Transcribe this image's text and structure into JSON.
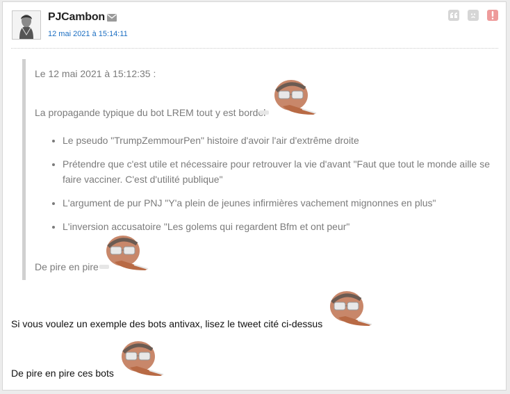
{
  "post": {
    "author": "PJCambon",
    "date": "12 mai 2021 à 15:14:11"
  },
  "icons": {
    "mail": "envelope-icon",
    "quote": "quote-icon",
    "sad": "sad-face-icon",
    "alert": "alert-icon"
  },
  "colors": {
    "date_link": "#1b6ec2",
    "quote_border": "#d0d0d0",
    "alert": "#ee9b9b"
  },
  "quote": {
    "header": "Le 12 mai 2021 à 15:12:35 :",
    "intro": "La propagande typique du bot LREM tout y est bordel",
    "items": [
      "Le pseudo \"TrumpZemmourPen\" histoire d'avoir l'air d'extrême droite",
      "Prétendre que c'est utile et nécessaire pour retrouver la vie d'avant \"Faut que tout le monde aille se faire vacciner. C'est d'utilité publique\"",
      "L'argument de pur PNJ \"Y'a plein de jeunes infirmières vachement mignonnes en plus\"",
      "L'inversion accusatoire \"Les golems qui regardent Bfm et ont peur\""
    ],
    "outro": "De pire en pire"
  },
  "reply": {
    "line1": "Si vous voulez un exemple des bots antivax, lisez le tweet cité ci-dessus",
    "line2": "De pire en pire ces bots"
  }
}
